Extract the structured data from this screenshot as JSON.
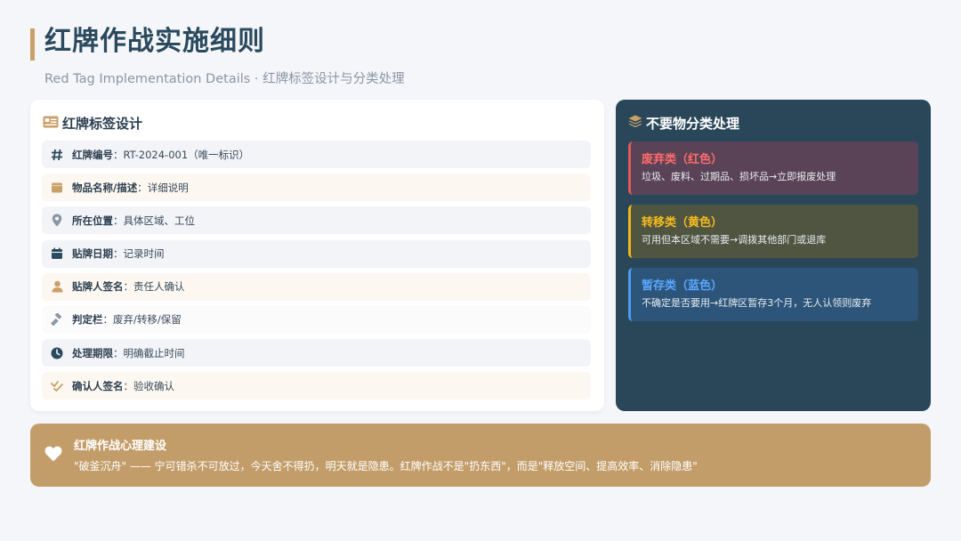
{
  "header": {
    "title": "红牌作战实施细则",
    "subtitle": "Red Tag Implementation Details · 红牌标签设计与分类处理"
  },
  "tag_design": {
    "heading": "红牌标签设计",
    "icon": "id-card-icon",
    "rows": [
      {
        "icon": "hash-icon",
        "key": "红牌编号",
        "value": "RT-2024-001（唯一标识）"
      },
      {
        "icon": "box-icon",
        "key": "物品名称/描述",
        "value": "详细说明"
      },
      {
        "icon": "location-pin-icon",
        "key": "所在位置",
        "value": "具体区域、工位"
      },
      {
        "icon": "calendar-icon",
        "key": "贴牌日期",
        "value": "记录时间"
      },
      {
        "icon": "user-icon",
        "key": "贴牌人签名",
        "value": "责任人确认"
      },
      {
        "icon": "gavel-icon",
        "key": "判定栏",
        "value": "废弃/转移/保留"
      },
      {
        "icon": "clock-icon",
        "key": "处理期限",
        "value": "明确截止时间"
      },
      {
        "icon": "check-double-icon",
        "key": "确认人签名",
        "value": "验收确认"
      }
    ]
  },
  "classification": {
    "heading": "不要物分类处理",
    "icon": "layers-icon",
    "categories": [
      {
        "title": "废弃类（红色）",
        "desc": "垃圾、废料、过期品、损坏品→立即报废处理",
        "color": "#ff6b6b"
      },
      {
        "title": "转移类（黄色）",
        "desc": "可用但本区域不需要→调拨其他部门或退库",
        "color": "#f7bd1e"
      },
      {
        "title": "暂存类（蓝色）",
        "desc": "不确定是否要用→红牌区暂存3个月，无人认领则废弃",
        "color": "#5aa8ff"
      }
    ]
  },
  "mindset": {
    "icon": "heart-icon",
    "title": "红牌作战心理建设",
    "text": "\"破釜沉舟\" —— 宁可错杀不可放过，今天舍不得扔，明天就是隐患。红牌作战不是\"扔东西\"，而是\"释放空间、提高效率、消除隐患\""
  },
  "colors": {
    "accent": "#c9a068",
    "navy": "#2a4759",
    "title": "#2b4a5e"
  }
}
